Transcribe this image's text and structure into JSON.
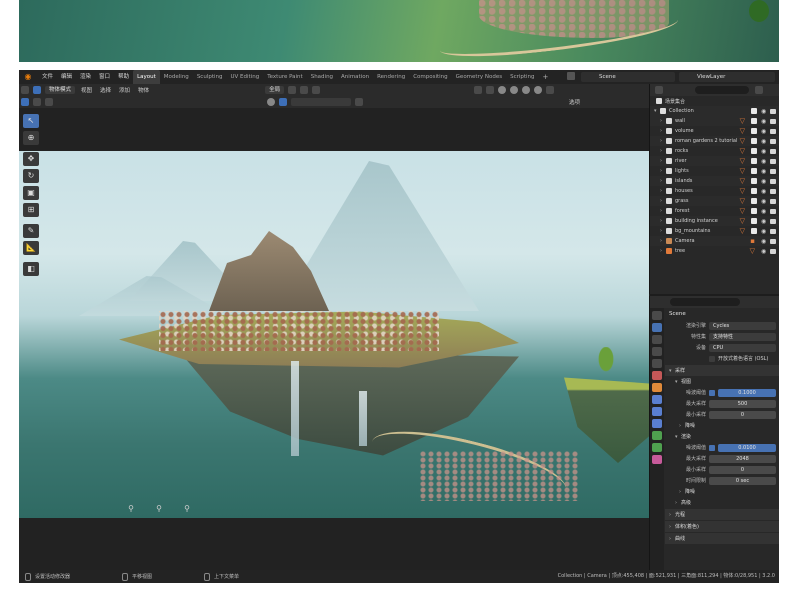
{
  "menu": {
    "items": [
      "文件",
      "编辑",
      "渲染",
      "窗口",
      "帮助"
    ],
    "workspaces": [
      "Layout",
      "Modeling",
      "Sculpting",
      "UV Editing",
      "Texture Paint",
      "Shading",
      "Animation",
      "Rendering",
      "Compositing",
      "Geometry Nodes",
      "Scripting"
    ],
    "active_workspace": "Layout",
    "add": "+",
    "scene": "Scene",
    "view_layer": "ViewLayer"
  },
  "viewport_header": {
    "mode": "物体模式",
    "menus": [
      "视图",
      "选择",
      "添加",
      "物体"
    ],
    "transform": "全局",
    "options": "选项"
  },
  "outliner": {
    "root": "场景集合",
    "collection": "Collection",
    "items": [
      {
        "label": "wall"
      },
      {
        "label": "volume"
      },
      {
        "label": "roman gardens 2 tutorial"
      },
      {
        "label": "rocks"
      },
      {
        "label": "river"
      },
      {
        "label": "lights"
      },
      {
        "label": "islands"
      },
      {
        "label": "houses"
      },
      {
        "label": "grass"
      },
      {
        "label": "forest"
      },
      {
        "label": "building instance"
      },
      {
        "label": "bg_mountains"
      },
      {
        "label": "Camera"
      },
      {
        "label": "tree"
      }
    ]
  },
  "properties": {
    "scene_name": "Scene",
    "render_engine_label": "渲染引擎",
    "render_engine": "Cycles",
    "feature_set_label": "特性集",
    "feature_set": "支持特性",
    "device_label": "设备",
    "device": "CPU",
    "osl_label": "开放式着色语言 (OSL)",
    "sampling": "采样",
    "viewport_section": "视图",
    "noise_threshold_label": "噪波阈值",
    "viewport_noise_threshold": "0.1000",
    "max_samples_label": "最大采样",
    "viewport_max_samples": "500",
    "min_samples_label": "最小采样",
    "viewport_min_samples": "0",
    "denoise": "降噪",
    "render_section": "渲染",
    "render_noise_threshold": "0.0100",
    "render_max_samples": "2048",
    "render_min_samples": "0",
    "time_limit_label": "时间限制",
    "time_limit": "0 sec",
    "denoise2": "降噪",
    "advanced": "高级",
    "light_paths": "光程",
    "volumes": "体积(着色)",
    "curves": "曲线"
  },
  "statusbar": {
    "select": "设置活动修改器",
    "pan": "平移视图",
    "menu": "上下文菜单",
    "stats": "Collection | Camera | 顶点:455,408 | 面:521,931 | 三角面:811,294 | 物体:0/28,951 | 3.2.0"
  }
}
